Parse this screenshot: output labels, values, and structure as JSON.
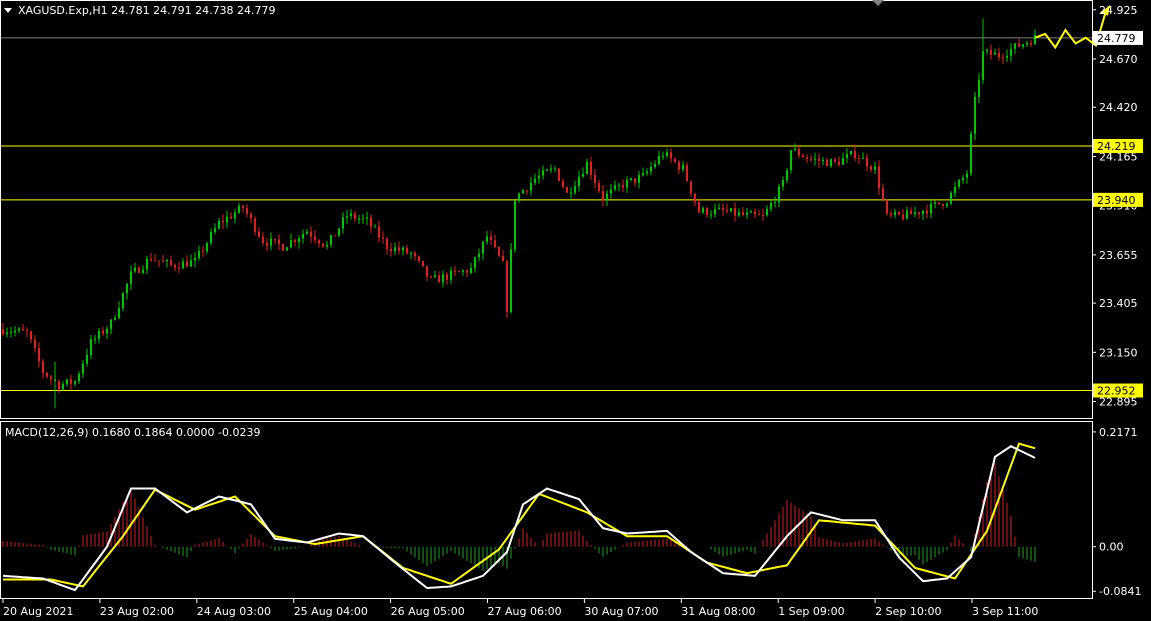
{
  "colors": {
    "background": "#000000",
    "axis": "#ffffff",
    "candle_up": "#00c800",
    "candle_down": "#e02020",
    "level_line": "#ffff00",
    "bid_line": "#808080",
    "bid_label_bg": "#ffffff",
    "macd_line": "#ffffff",
    "signal_line": "#ffff00",
    "hist_up": "#d02020",
    "hist_down": "#20a020",
    "forecast": "#ffff00"
  },
  "header": {
    "symbol_line": "XAGUSD.Exp,H1  24.781 24.791 24.738 24.779"
  },
  "macd_panel": {
    "title": "MACD(12,26,9) 0.1680 0.1864 0.0000 -0.0239",
    "ticks": [
      "0.2171",
      "0.00",
      "-0.0841"
    ]
  },
  "price_axis": {
    "ticks": [
      "24.925",
      "24.670",
      "24.420",
      "24.165",
      "23.910",
      "23.655",
      "23.405",
      "23.150",
      "22.895"
    ]
  },
  "levels": [
    {
      "label": "24.219",
      "value": 24.219
    },
    {
      "label": "23.940",
      "value": 23.94
    },
    {
      "label": "22.952",
      "value": 22.952
    }
  ],
  "bid": {
    "label": "24.779",
    "value": 24.779
  },
  "time_axis": {
    "labels": [
      "20 Aug 2021",
      "23 Aug 02:00",
      "24 Aug 03:00",
      "25 Aug 04:00",
      "26 Aug 05:00",
      "27 Aug 06:00",
      "30 Aug 07:00",
      "31 Aug 08:00",
      "1 Sep 09:00",
      "2 Sep 10:00",
      "3 Sep 11:00"
    ]
  },
  "chart_data": {
    "type": "candlestick",
    "symbol": "XAGUSD.Exp",
    "timeframe": "H1",
    "price_range": [
      22.82,
      24.96
    ],
    "macd_range": [
      -0.095,
      0.232
    ],
    "close_path": [
      {
        "bar": 0,
        "close": 23.27
      },
      {
        "bar": 6,
        "close": 23.25
      },
      {
        "bar": 10,
        "close": 23.05
      },
      {
        "bar": 14,
        "close": 22.98
      },
      {
        "bar": 18,
        "close": 23.0
      },
      {
        "bar": 22,
        "close": 23.2
      },
      {
        "bar": 27,
        "close": 23.3
      },
      {
        "bar": 32,
        "close": 23.55
      },
      {
        "bar": 37,
        "close": 23.64
      },
      {
        "bar": 42,
        "close": 23.6
      },
      {
        "bar": 48,
        "close": 23.62
      },
      {
        "bar": 54,
        "close": 23.82
      },
      {
        "bar": 60,
        "close": 23.9
      },
      {
        "bar": 65,
        "close": 23.73
      },
      {
        "bar": 70,
        "close": 23.7
      },
      {
        "bar": 76,
        "close": 23.78
      },
      {
        "bar": 81,
        "close": 23.7
      },
      {
        "bar": 86,
        "close": 23.86
      },
      {
        "bar": 91,
        "close": 23.83
      },
      {
        "bar": 96,
        "close": 23.7
      },
      {
        "bar": 102,
        "close": 23.66
      },
      {
        "bar": 107,
        "close": 23.52
      },
      {
        "bar": 112,
        "close": 23.55
      },
      {
        "bar": 117,
        "close": 23.58
      },
      {
        "bar": 121,
        "close": 23.75
      },
      {
        "bar": 125,
        "close": 23.6
      },
      {
        "bar": 126,
        "close": 23.38
      },
      {
        "bar": 128,
        "close": 23.95
      },
      {
        "bar": 133,
        "close": 24.05
      },
      {
        "bar": 138,
        "close": 24.1
      },
      {
        "bar": 141,
        "close": 23.97
      },
      {
        "bar": 146,
        "close": 24.13
      },
      {
        "bar": 150,
        "close": 23.95
      },
      {
        "bar": 155,
        "close": 24.02
      },
      {
        "bar": 160,
        "close": 24.06
      },
      {
        "bar": 165,
        "close": 24.18
      },
      {
        "bar": 170,
        "close": 24.1
      },
      {
        "bar": 174,
        "close": 23.88
      },
      {
        "bar": 180,
        "close": 23.88
      },
      {
        "bar": 185,
        "close": 23.86
      },
      {
        "bar": 190,
        "close": 23.85
      },
      {
        "bar": 195,
        "close": 24.02
      },
      {
        "bar": 197,
        "close": 24.2
      },
      {
        "bar": 202,
        "close": 24.15
      },
      {
        "bar": 208,
        "close": 24.13
      },
      {
        "bar": 213,
        "close": 24.18
      },
      {
        "bar": 218,
        "close": 24.1
      },
      {
        "bar": 221,
        "close": 23.85
      },
      {
        "bar": 226,
        "close": 23.86
      },
      {
        "bar": 232,
        "close": 23.9
      },
      {
        "bar": 236,
        "close": 23.94
      },
      {
        "bar": 241,
        "close": 24.08
      },
      {
        "bar": 243,
        "close": 24.45
      },
      {
        "bar": 245,
        "close": 24.7
      },
      {
        "bar": 249,
        "close": 24.69
      },
      {
        "bar": 253,
        "close": 24.73
      },
      {
        "bar": 258,
        "close": 24.78
      }
    ],
    "macd_path": [
      {
        "bar": 0,
        "value": -0.055
      },
      {
        "bar": 10,
        "value": -0.06
      },
      {
        "bar": 18,
        "value": -0.082
      },
      {
        "bar": 26,
        "value": 0.0
      },
      {
        "bar": 32,
        "value": 0.11
      },
      {
        "bar": 38,
        "value": 0.11
      },
      {
        "bar": 46,
        "value": 0.065
      },
      {
        "bar": 54,
        "value": 0.095
      },
      {
        "bar": 62,
        "value": 0.08
      },
      {
        "bar": 68,
        "value": 0.015
      },
      {
        "bar": 76,
        "value": 0.008
      },
      {
        "bar": 84,
        "value": 0.025
      },
      {
        "bar": 90,
        "value": 0.02
      },
      {
        "bar": 98,
        "value": -0.03
      },
      {
        "bar": 106,
        "value": -0.078
      },
      {
        "bar": 112,
        "value": -0.075
      },
      {
        "bar": 120,
        "value": -0.055
      },
      {
        "bar": 126,
        "value": -0.01
      },
      {
        "bar": 130,
        "value": 0.08
      },
      {
        "bar": 136,
        "value": 0.11
      },
      {
        "bar": 144,
        "value": 0.09
      },
      {
        "bar": 150,
        "value": 0.035
      },
      {
        "bar": 156,
        "value": 0.025
      },
      {
        "bar": 166,
        "value": 0.03
      },
      {
        "bar": 172,
        "value": -0.01
      },
      {
        "bar": 180,
        "value": -0.05
      },
      {
        "bar": 188,
        "value": -0.055
      },
      {
        "bar": 196,
        "value": 0.02
      },
      {
        "bar": 202,
        "value": 0.065
      },
      {
        "bar": 210,
        "value": 0.05
      },
      {
        "bar": 218,
        "value": 0.05
      },
      {
        "bar": 224,
        "value": -0.02
      },
      {
        "bar": 230,
        "value": -0.065
      },
      {
        "bar": 236,
        "value": -0.06
      },
      {
        "bar": 242,
        "value": -0.02
      },
      {
        "bar": 248,
        "value": 0.17
      },
      {
        "bar": 252,
        "value": 0.19
      },
      {
        "bar": 258,
        "value": 0.168
      }
    ],
    "signal_path": [
      {
        "bar": 0,
        "value": -0.062
      },
      {
        "bar": 12,
        "value": -0.062
      },
      {
        "bar": 20,
        "value": -0.075
      },
      {
        "bar": 30,
        "value": 0.02
      },
      {
        "bar": 38,
        "value": 0.108
      },
      {
        "bar": 48,
        "value": 0.07
      },
      {
        "bar": 58,
        "value": 0.095
      },
      {
        "bar": 68,
        "value": 0.02
      },
      {
        "bar": 78,
        "value": 0.005
      },
      {
        "bar": 90,
        "value": 0.02
      },
      {
        "bar": 100,
        "value": -0.04
      },
      {
        "bar": 112,
        "value": -0.07
      },
      {
        "bar": 124,
        "value": -0.005
      },
      {
        "bar": 134,
        "value": 0.1
      },
      {
        "bar": 146,
        "value": 0.065
      },
      {
        "bar": 156,
        "value": 0.02
      },
      {
        "bar": 166,
        "value": 0.02
      },
      {
        "bar": 176,
        "value": -0.03
      },
      {
        "bar": 186,
        "value": -0.05
      },
      {
        "bar": 196,
        "value": -0.035
      },
      {
        "bar": 204,
        "value": 0.05
      },
      {
        "bar": 218,
        "value": 0.04
      },
      {
        "bar": 228,
        "value": -0.04
      },
      {
        "bar": 238,
        "value": -0.06
      },
      {
        "bar": 246,
        "value": 0.03
      },
      {
        "bar": 254,
        "value": 0.195
      },
      {
        "bar": 258,
        "value": 0.186
      }
    ],
    "forecast_zigzag": [
      24.78,
      24.8,
      24.73,
      24.82,
      24.75,
      24.78,
      24.74,
      24.92
    ]
  }
}
